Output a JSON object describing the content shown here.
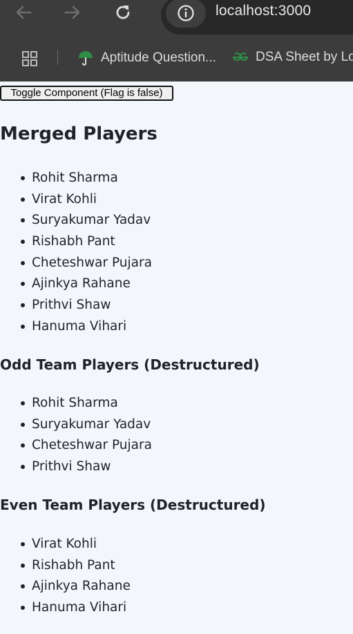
{
  "browser": {
    "url": "localhost:3000",
    "bookmarks": [
      {
        "label": "Aptitude Question...",
        "icon": "umbrella-icon"
      },
      {
        "label": "DSA Sheet by Lov",
        "icon": "geeksforgeeks-icon"
      }
    ]
  },
  "page": {
    "toggle_label": "Toggle Component (Flag is false)",
    "merged": {
      "heading": "Merged Players",
      "players": [
        "Rohit Sharma",
        "Virat Kohli",
        "Suryakumar Yadav",
        "Rishabh Pant",
        "Cheteshwar Pujara",
        "Ajinkya Rahane",
        "Prithvi Shaw",
        "Hanuma Vihari"
      ]
    },
    "odd": {
      "heading": "Odd Team Players (Destructured)",
      "players": [
        "Rohit Sharma",
        "Suryakumar Yadav",
        "Cheteshwar Pujara",
        "Prithvi Shaw"
      ]
    },
    "even": {
      "heading": "Even Team Players (Destructured)",
      "players": [
        "Virat Kohli",
        "Rishabh Pant",
        "Ajinkya Rahane",
        "Hanuma Vihari"
      ]
    }
  },
  "colors": {
    "chrome_bg": "#3c3c3c",
    "page_bg": "#f3f6fa",
    "text": "#1f2328",
    "bookmark_green": "#2f8d46"
  }
}
